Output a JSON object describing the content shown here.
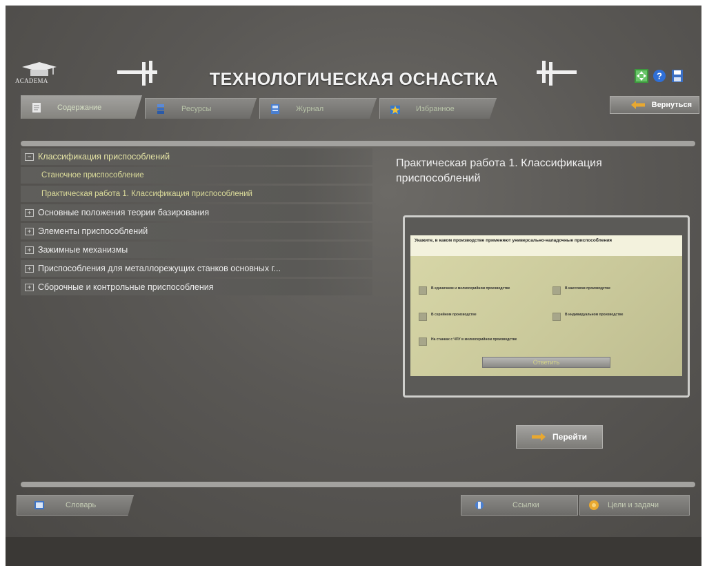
{
  "header": {
    "logo_text": "ACADEMA",
    "title": "ТЕХНОЛОГИЧЕСКАЯ ОСНАСТКА",
    "icons": [
      "fullscreen-icon",
      "help-icon",
      "save-icon"
    ]
  },
  "tabs": [
    {
      "label": "Содержание",
      "icon": "contents-icon",
      "active": true
    },
    {
      "label": "Ресурсы",
      "icon": "resources-icon",
      "active": false
    },
    {
      "label": "Журнал",
      "icon": "journal-icon",
      "active": false
    },
    {
      "label": "Избранное",
      "icon": "favorites-icon",
      "active": false
    }
  ],
  "back_button": {
    "label": "Вернуться",
    "icon": "arrow-left-icon"
  },
  "tree": [
    {
      "label": "Классификация приспособлений",
      "expanded": true,
      "children": [
        {
          "label": "Станочное приспособление"
        },
        {
          "label": "Практическая работа 1. Классификация приспособлений"
        }
      ]
    },
    {
      "label": "Основные положения теории базирования",
      "expanded": false
    },
    {
      "label": "Элементы приспособлений",
      "expanded": false
    },
    {
      "label": "Зажимные механизмы",
      "expanded": false
    },
    {
      "label": "Приспособления для металлорежущих станков основных г...",
      "expanded": false
    },
    {
      "label": "Сборочные и контрольные приспособления",
      "expanded": false
    }
  ],
  "content": {
    "heading": "Практическая работа 1. Классификация приспособлений",
    "preview": {
      "question": "Укажите, в каком производстве применяют универсально-наладочные приспособления",
      "options": [
        "В единичном и мелкосерийном производстве",
        "В массовом производстве",
        "В серийном производстве",
        "В индивидуальном производстве",
        "На станках с ЧПУ в мелкосерийном производстве"
      ],
      "answer_label": "Ответить"
    },
    "go_button": "Перейти"
  },
  "footer": {
    "glossary": "Словарь",
    "links": "Ссылки",
    "goals": "Цели и задачи"
  },
  "colors": {
    "background": "#5a5855",
    "accent_text": "#e7e6a6",
    "arrow": "#e8a830"
  }
}
